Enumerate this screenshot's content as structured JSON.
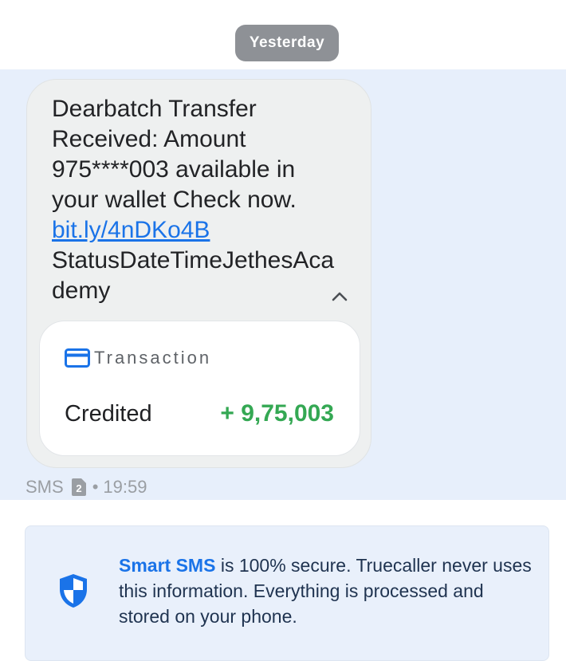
{
  "date_chip": "Yesterday",
  "message": {
    "text_before_link": "Dearbatch Transfer Received:  Amount 975****003 available in your wallet Check now.",
    "link": "bit.ly/4nDKo4B",
    "text_after_link": "StatusDateTimeJethesAcademy"
  },
  "transaction": {
    "title": "Transaction",
    "label": "Credited",
    "amount": "+ 9,75,003",
    "amount_color": "#34a853"
  },
  "meta": {
    "source": "SMS",
    "sim": "2",
    "separator": "•",
    "time": "19:59"
  },
  "secure_note": {
    "brand": "Smart SMS",
    "text": " is 100% secure. Truecaller never uses this information. Everything is processed and stored on your phone."
  },
  "icons": {
    "collapse": "chevron-up-icon",
    "card": "credit-card-icon",
    "sim": "sim-card-icon",
    "security": "shield-icon"
  },
  "colors": {
    "accent": "#1a73e8",
    "highlight": "#e7effb",
    "bubble": "#eef0f0",
    "date_chip": "#8e9196"
  }
}
